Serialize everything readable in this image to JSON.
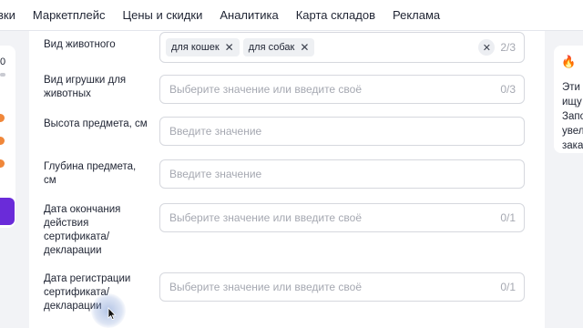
{
  "topnav": {
    "items": [
      "вки",
      "Маркетплейс",
      "Цены и скидки",
      "Аналитика",
      "Карта складов",
      "Реклама"
    ]
  },
  "left_panel": {
    "value_fragment": "0"
  },
  "form": {
    "rows": [
      {
        "label": "Вид животного",
        "chips": [
          {
            "text": "для кошек"
          },
          {
            "text": "для собак"
          }
        ],
        "clear_icon": "close-icon",
        "counter": "2/3"
      },
      {
        "label": "Вид игрушки для животных",
        "placeholder": "Выберите значение или введите своё",
        "counter": "0/3"
      },
      {
        "label": "Высота предмета, см",
        "placeholder": "Введите значение"
      },
      {
        "label": "Глубина предмета, см",
        "placeholder": "Введите значение"
      },
      {
        "label": "Дата окончания действия сертификата/декларации",
        "placeholder": "Выберите значение или введите своё",
        "counter": "0/1"
      },
      {
        "label": "Дата регистрации сертификата/декларации",
        "placeholder": "Выберите значение или введите своё",
        "counter": "0/1"
      }
    ]
  },
  "tip": {
    "icon": "fire-icon",
    "lines": [
      "Эти",
      "ищу",
      "Запо",
      "увел",
      "зака"
    ]
  },
  "colors": {
    "accent": "#6a2bd9",
    "status_dot": "#f0873a",
    "border": "#d6d8de",
    "placeholder": "#a5a8b1"
  }
}
